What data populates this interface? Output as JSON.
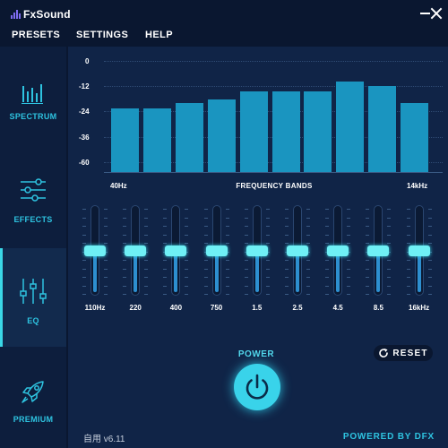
{
  "app": {
    "name": "FxSound",
    "logo_icon": "equalizer-bars-icon",
    "window_controls": [
      "minimize-icon",
      "close-icon"
    ]
  },
  "menu": [
    "PRESETS",
    "SETTINGS",
    "HELP"
  ],
  "sidebar": {
    "active": "EQ",
    "items": [
      {
        "label": "SPECTRUM",
        "icon": "spectrum-bars-icon"
      },
      {
        "label": "EFFECTS",
        "icon": "sliders-horizontal-icon"
      },
      {
        "label": "EQ",
        "icon": "sliders-vertical-icon"
      },
      {
        "label": "PREMIUM",
        "icon": "rocket-icon"
      }
    ]
  },
  "spectrum": {
    "db_labels": [
      "0",
      "-12",
      "-24",
      "-36",
      "-60"
    ],
    "bar_levels": [
      -28,
      -28,
      -25,
      -23,
      -18,
      -18,
      -18,
      -12,
      -15,
      -25
    ],
    "freq_low": "40Hz",
    "freq_title": "FREQUENCY BANDS",
    "freq_high": "14kHz",
    "colors": {
      "bar": "#1a95c0"
    }
  },
  "eq": {
    "bands": [
      "110Hz",
      "220",
      "400",
      "750",
      "1.5",
      "2.5",
      "4.5",
      "8.5",
      "16kHz"
    ],
    "levels": [
      0.5,
      0.5,
      0.5,
      0.5,
      0.5,
      0.5,
      0.5,
      0.5,
      0.5
    ],
    "colors": {
      "thumb": "#6ff0f5",
      "fill": "#2d8fd0"
    }
  },
  "power": {
    "label": "POWER",
    "icon": "power-icon",
    "state": "on"
  },
  "reset": {
    "label": "RESET",
    "icon": "refresh-icon"
  },
  "footer": {
    "version": "自用 v6.11",
    "powered": "POWERED BY DFX"
  },
  "colors": {
    "accent": "#2ec3e0",
    "background": "#0a1730",
    "panel": "#102447",
    "sidebar": "#0d1e3d"
  }
}
